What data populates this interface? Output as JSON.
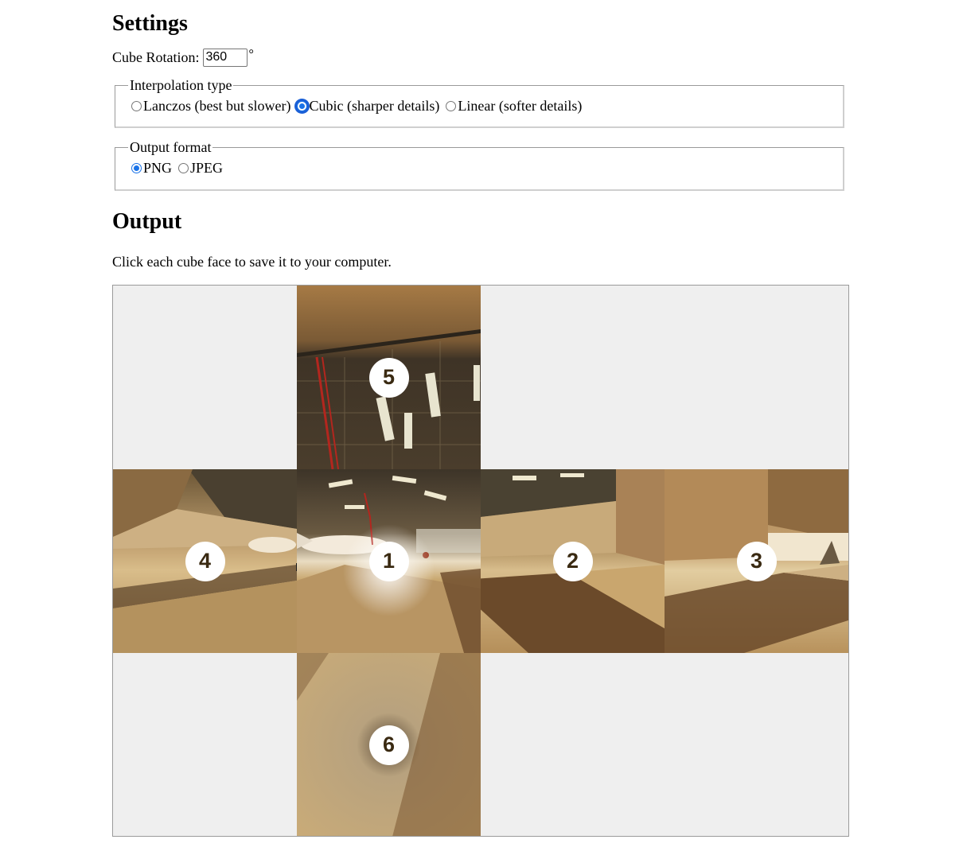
{
  "settings": {
    "heading": "Settings",
    "rotation_label": "Cube Rotation:",
    "rotation_value": "360",
    "rotation_unit": "°",
    "interpolation": {
      "legend": "Interpolation type",
      "options": [
        {
          "label": "Lanczos (best but slower)",
          "selected": false
        },
        {
          "label": "Cubic (sharper details)",
          "selected": true
        },
        {
          "label": "Linear (softer details)",
          "selected": false
        }
      ]
    },
    "output_format": {
      "legend": "Output format",
      "options": [
        {
          "label": "PNG",
          "selected": true
        },
        {
          "label": "JPEG",
          "selected": false
        }
      ]
    }
  },
  "output": {
    "heading": "Output",
    "description": "Click each cube face to save it to your computer.",
    "faces": [
      {
        "number": "1",
        "kind": "front"
      },
      {
        "number": "2",
        "kind": "right"
      },
      {
        "number": "3",
        "kind": "back"
      },
      {
        "number": "4",
        "kind": "left"
      },
      {
        "number": "5",
        "kind": "ceiling"
      },
      {
        "number": "6",
        "kind": "floor"
      }
    ]
  },
  "colors": {
    "radio_accent": "#1a73e8",
    "canvas_background": "#efefef",
    "badge_text": "#3a2a12"
  }
}
